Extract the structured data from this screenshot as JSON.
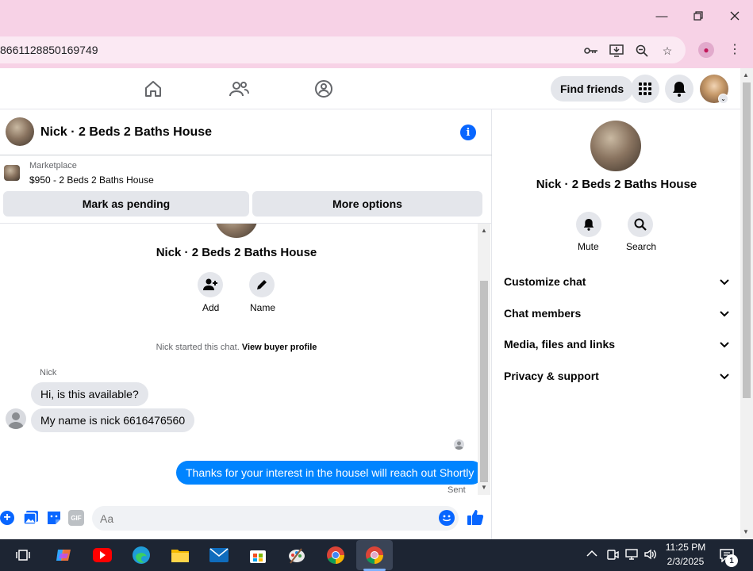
{
  "browser": {
    "url": "8661128850169749"
  },
  "fb_nav": {
    "find_friends": "Find friends"
  },
  "chat": {
    "title": "Nick · 2 Beds 2 Baths House",
    "marketplace_label": "Marketplace",
    "listing": "$950 - 2 Beds 2 Baths House",
    "mark_pending": "Mark as pending",
    "more_options": "More options",
    "intro_name": "Nick · 2 Beds 2 Baths House",
    "add_label": "Add",
    "name_label": "Name",
    "started_text": "Nick started this chat.",
    "view_profile": "View buyer profile",
    "sender_name": "Nick",
    "messages_in": [
      "Hi, is this available?",
      "My name is nick 6616476560"
    ],
    "message_out": "Thanks for your interest in the housel will reach out Shortly",
    "sent_status": "Sent",
    "input_placeholder": "Aa"
  },
  "panel": {
    "name": "Nick · 2 Beds 2 Baths House",
    "mute": "Mute",
    "search": "Search",
    "sections": [
      "Customize chat",
      "Chat members",
      "Media, files and links",
      "Privacy & support"
    ]
  },
  "taskbar": {
    "time": "11:25 PM",
    "date": "2/3/2025",
    "notif_count": "1"
  },
  "colors": {
    "accent": "#0866ff",
    "bubble_out": "#0084ff",
    "titlebar": "#f7d2e6"
  }
}
